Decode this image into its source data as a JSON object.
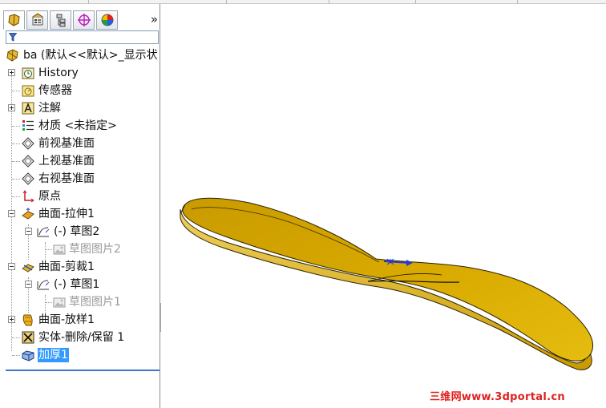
{
  "panel": {
    "tabs": [
      {
        "name": "feature-manager",
        "icon": "feature-manager-icon"
      },
      {
        "name": "property-manager",
        "icon": "property-manager-icon"
      },
      {
        "name": "configuration-manager",
        "icon": "configuration-manager-icon"
      },
      {
        "name": "dimxpert-manager",
        "icon": "dimxpert-icon"
      },
      {
        "name": "display-manager",
        "icon": "display-manager-icon"
      }
    ],
    "more_label": "»",
    "filter_placeholder": ""
  },
  "tree": {
    "root": "ba  (默认<<默认>_显示状",
    "items": [
      {
        "label": "History",
        "icon": "history-icon",
        "expandable": true
      },
      {
        "label": "传感器",
        "icon": "sensor-icon",
        "expandable": false
      },
      {
        "label": "注解",
        "icon": "annotation-icon",
        "expandable": true
      },
      {
        "label": "材质 <未指定>",
        "icon": "material-icon",
        "expandable": false
      },
      {
        "label": "前视基准面",
        "icon": "plane-icon",
        "expandable": false
      },
      {
        "label": "上视基准面",
        "icon": "plane-icon",
        "expandable": false
      },
      {
        "label": "右视基准面",
        "icon": "plane-icon",
        "expandable": false
      },
      {
        "label": "原点",
        "icon": "origin-icon",
        "expandable": false
      },
      {
        "label": "曲面-拉伸1",
        "icon": "surface-extrude-icon",
        "expandable": true
      },
      {
        "label": "(-) 草图2",
        "icon": "sketch-icon",
        "expandable": true
      },
      {
        "label": "草图图片2",
        "icon": "sketch-picture-icon",
        "expandable": false
      },
      {
        "label": "曲面-剪裁1",
        "icon": "surface-trim-icon",
        "expandable": true
      },
      {
        "label": "(-) 草图1",
        "icon": "sketch-icon",
        "expandable": true
      },
      {
        "label": "草图图片1",
        "icon": "sketch-picture-icon",
        "expandable": false
      },
      {
        "label": "曲面-放样1",
        "icon": "surface-loft-icon",
        "expandable": true
      },
      {
        "label": "实体-删除/保留 1",
        "icon": "delete-body-icon",
        "expandable": false
      },
      {
        "label": "加厚1",
        "icon": "thicken-icon",
        "expandable": false,
        "selected": true
      }
    ]
  },
  "viewport": {
    "model_color": "#d2a200",
    "watermark": "三维网www.3dportal.cn"
  },
  "colors": {
    "selection": "#3399ff",
    "accent_blue": "#2a3ad0"
  }
}
